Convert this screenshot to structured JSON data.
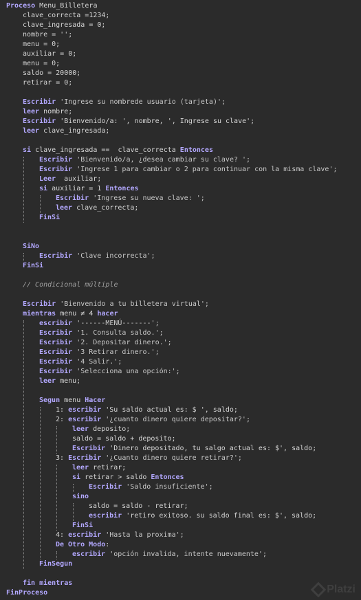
{
  "code_lines": [
    {
      "indent": 0,
      "tokens": [
        {
          "t": "Proceso",
          "c": "kw"
        },
        {
          "t": " Menu_Billetera"
        }
      ]
    },
    {
      "indent": 1,
      "tokens": [
        {
          "t": "clave_correcta =1234;"
        }
      ]
    },
    {
      "indent": 1,
      "tokens": [
        {
          "t": "clave_ingresada = 0;"
        }
      ]
    },
    {
      "indent": 1,
      "tokens": [
        {
          "t": "nombre = '';"
        }
      ]
    },
    {
      "indent": 1,
      "tokens": [
        {
          "t": "menu = 0;"
        }
      ]
    },
    {
      "indent": 1,
      "tokens": [
        {
          "t": "auxiliar = 0;"
        }
      ]
    },
    {
      "indent": 1,
      "tokens": [
        {
          "t": "menu = 0;"
        }
      ]
    },
    {
      "indent": 1,
      "tokens": [
        {
          "t": "saldo = 20000;"
        }
      ]
    },
    {
      "indent": 1,
      "tokens": [
        {
          "t": "retirar = 0;"
        }
      ]
    },
    {
      "indent": 0,
      "tokens": []
    },
    {
      "indent": 1,
      "tokens": [
        {
          "t": "Escribir",
          "c": "kw"
        },
        {
          "t": " 'Ingrese su nombrede usuario (tarjeta)';",
          "c": "str"
        }
      ]
    },
    {
      "indent": 1,
      "tokens": [
        {
          "t": "leer",
          "c": "kw"
        },
        {
          "t": " nombre;"
        }
      ]
    },
    {
      "indent": 1,
      "tokens": [
        {
          "t": "Escribir",
          "c": "kw"
        },
        {
          "t": " 'Bienvenido/a: ', nombre, ', Ingrese su clave';"
        }
      ]
    },
    {
      "indent": 1,
      "tokens": [
        {
          "t": "leer",
          "c": "kw"
        },
        {
          "t": " clave_ingresada;"
        }
      ]
    },
    {
      "indent": 0,
      "tokens": []
    },
    {
      "indent": 1,
      "tokens": [
        {
          "t": "si",
          "c": "kw"
        },
        {
          "t": " clave_ingresada ==  clave_correcta "
        },
        {
          "t": "Entonces",
          "c": "kw"
        }
      ]
    },
    {
      "indent": 2,
      "tokens": [
        {
          "t": "Escribir",
          "c": "kw"
        },
        {
          "t": " 'Bienvenido/a, ¿desea cambiar su clave? ';",
          "c": "str"
        }
      ]
    },
    {
      "indent": 2,
      "tokens": [
        {
          "t": "Escribir",
          "c": "kw"
        },
        {
          "t": " 'Ingrese 1 para cambiar o 2 para continuar con la misma clave';",
          "c": "str"
        }
      ]
    },
    {
      "indent": 2,
      "tokens": [
        {
          "t": "Leer",
          "c": "kw"
        },
        {
          "t": "  auxiliar;"
        }
      ]
    },
    {
      "indent": 2,
      "tokens": [
        {
          "t": "si",
          "c": "kw"
        },
        {
          "t": " auxiliar = 1 "
        },
        {
          "t": "Entonces",
          "c": "kw"
        }
      ]
    },
    {
      "indent": 3,
      "tokens": [
        {
          "t": "Escribir",
          "c": "kw"
        },
        {
          "t": " 'Ingrese su nueva clave: ';",
          "c": "str"
        }
      ]
    },
    {
      "indent": 3,
      "tokens": [
        {
          "t": "leer",
          "c": "kw"
        },
        {
          "t": " clave_correcta;"
        }
      ]
    },
    {
      "indent": 2,
      "tokens": [
        {
          "t": "FinSi",
          "c": "kw"
        }
      ]
    },
    {
      "indent": 0,
      "tokens": []
    },
    {
      "indent": 0,
      "tokens": []
    },
    {
      "indent": 1,
      "tokens": [
        {
          "t": "SiNo",
          "c": "kw"
        }
      ]
    },
    {
      "indent": 2,
      "tokens": [
        {
          "t": "Escribir",
          "c": "kw"
        },
        {
          "t": " 'Clave incorrecta';",
          "c": "str"
        }
      ]
    },
    {
      "indent": 1,
      "tokens": [
        {
          "t": "FinSi",
          "c": "kw"
        }
      ]
    },
    {
      "indent": 0,
      "tokens": []
    },
    {
      "indent": 1,
      "tokens": [
        {
          "t": "// Condicional múltiple",
          "c": "cm"
        }
      ]
    },
    {
      "indent": 0,
      "tokens": []
    },
    {
      "indent": 1,
      "tokens": [
        {
          "t": "Escribir",
          "c": "kw"
        },
        {
          "t": " 'Bienvenido a tu billetera virtual';",
          "c": "str"
        }
      ]
    },
    {
      "indent": 1,
      "tokens": [
        {
          "t": "mientras",
          "c": "kw"
        },
        {
          "t": " menu ≠ 4 "
        },
        {
          "t": "hacer",
          "c": "kw"
        }
      ]
    },
    {
      "indent": 2,
      "tokens": [
        {
          "t": "escribir",
          "c": "kw"
        },
        {
          "t": " '------MENÚ-------';",
          "c": "str"
        }
      ]
    },
    {
      "indent": 2,
      "tokens": [
        {
          "t": "Escribir",
          "c": "kw"
        },
        {
          "t": " '1. Consulta saldo.';",
          "c": "str"
        }
      ]
    },
    {
      "indent": 2,
      "tokens": [
        {
          "t": "Escribir",
          "c": "kw"
        },
        {
          "t": " '2. Depositar dinero.';",
          "c": "str"
        }
      ]
    },
    {
      "indent": 2,
      "tokens": [
        {
          "t": "Escribir",
          "c": "kw"
        },
        {
          "t": " '3 Retirar dinero.';",
          "c": "str"
        }
      ]
    },
    {
      "indent": 2,
      "tokens": [
        {
          "t": "Escribir",
          "c": "kw"
        },
        {
          "t": " '4 Salir.';",
          "c": "str"
        }
      ]
    },
    {
      "indent": 2,
      "tokens": [
        {
          "t": "Escribir",
          "c": "kw"
        },
        {
          "t": " 'Selecciona una opción:';",
          "c": "str"
        }
      ]
    },
    {
      "indent": 2,
      "tokens": [
        {
          "t": "leer",
          "c": "kw"
        },
        {
          "t": " menu;"
        }
      ]
    },
    {
      "indent": 0,
      "tokens": []
    },
    {
      "indent": 2,
      "tokens": [
        {
          "t": "Segun",
          "c": "kw"
        },
        {
          "t": " menu "
        },
        {
          "t": "Hacer",
          "c": "kw"
        }
      ]
    },
    {
      "indent": 3,
      "tokens": [
        {
          "t": "1: "
        },
        {
          "t": "escribir",
          "c": "kw"
        },
        {
          "t": " 'Su saldo actual es: $ ', saldo;"
        }
      ]
    },
    {
      "indent": 3,
      "tokens": [
        {
          "t": "2: "
        },
        {
          "t": "escribir",
          "c": "kw"
        },
        {
          "t": " '¿cuanto dinero quiere depositar?';",
          "c": "str"
        }
      ]
    },
    {
      "indent": 4,
      "tokens": [
        {
          "t": "leer",
          "c": "kw"
        },
        {
          "t": " deposito;"
        }
      ]
    },
    {
      "indent": 4,
      "tokens": [
        {
          "t": "saldo = saldo + deposito;"
        }
      ]
    },
    {
      "indent": 4,
      "tokens": [
        {
          "t": "Escribir",
          "c": "kw"
        },
        {
          "t": " 'Dinero depositado, tu salgo actual es: $', saldo;"
        }
      ]
    },
    {
      "indent": 3,
      "tokens": [
        {
          "t": "3: "
        },
        {
          "t": "Escribir",
          "c": "kw"
        },
        {
          "t": " '¿Cuanto dinero quiere retirar?';",
          "c": "str"
        }
      ]
    },
    {
      "indent": 4,
      "tokens": [
        {
          "t": "leer",
          "c": "kw"
        },
        {
          "t": " retirar;"
        }
      ]
    },
    {
      "indent": 4,
      "tokens": [
        {
          "t": "si",
          "c": "kw"
        },
        {
          "t": " retirar > saldo "
        },
        {
          "t": "Entonces",
          "c": "kw"
        }
      ]
    },
    {
      "indent": 5,
      "tokens": [
        {
          "t": "Escribir",
          "c": "kw"
        },
        {
          "t": " 'Saldo insuficiente';",
          "c": "str"
        }
      ]
    },
    {
      "indent": 4,
      "tokens": [
        {
          "t": "sino",
          "c": "kw"
        }
      ]
    },
    {
      "indent": 5,
      "tokens": [
        {
          "t": "saldo = saldo - retirar;"
        }
      ]
    },
    {
      "indent": 5,
      "tokens": [
        {
          "t": "escribir",
          "c": "kw"
        },
        {
          "t": " 'retiro exitoso. su saldo final es: $', saldo;"
        }
      ]
    },
    {
      "indent": 4,
      "tokens": [
        {
          "t": "FinSi",
          "c": "kw"
        }
      ]
    },
    {
      "indent": 3,
      "tokens": [
        {
          "t": "4: "
        },
        {
          "t": "escribir",
          "c": "kw"
        },
        {
          "t": " 'Hasta la proxima';",
          "c": "str"
        }
      ]
    },
    {
      "indent": 3,
      "tokens": [
        {
          "t": "De Otro Modo",
          "c": "kw"
        },
        {
          "t": ":"
        }
      ]
    },
    {
      "indent": 4,
      "tokens": [
        {
          "t": "escribir",
          "c": "kw"
        },
        {
          "t": " 'opción invalida, intente nuevamente';",
          "c": "str"
        }
      ]
    },
    {
      "indent": 2,
      "tokens": [
        {
          "t": "FinSegun",
          "c": "kw"
        }
      ]
    },
    {
      "indent": 0,
      "tokens": []
    },
    {
      "indent": 1,
      "tokens": [
        {
          "t": "fin mientras",
          "c": "kw"
        }
      ]
    },
    {
      "indent": 0,
      "tokens": [
        {
          "t": "FinProceso",
          "c": "kw"
        }
      ]
    }
  ],
  "colors": {
    "background": "#2b2b2b",
    "keyword": "#b3a8ff",
    "text": "#d6d6d6",
    "comment": "#a0a0a0"
  },
  "watermark": {
    "text": "Platzi",
    "icon": "platzi-logo-icon"
  }
}
